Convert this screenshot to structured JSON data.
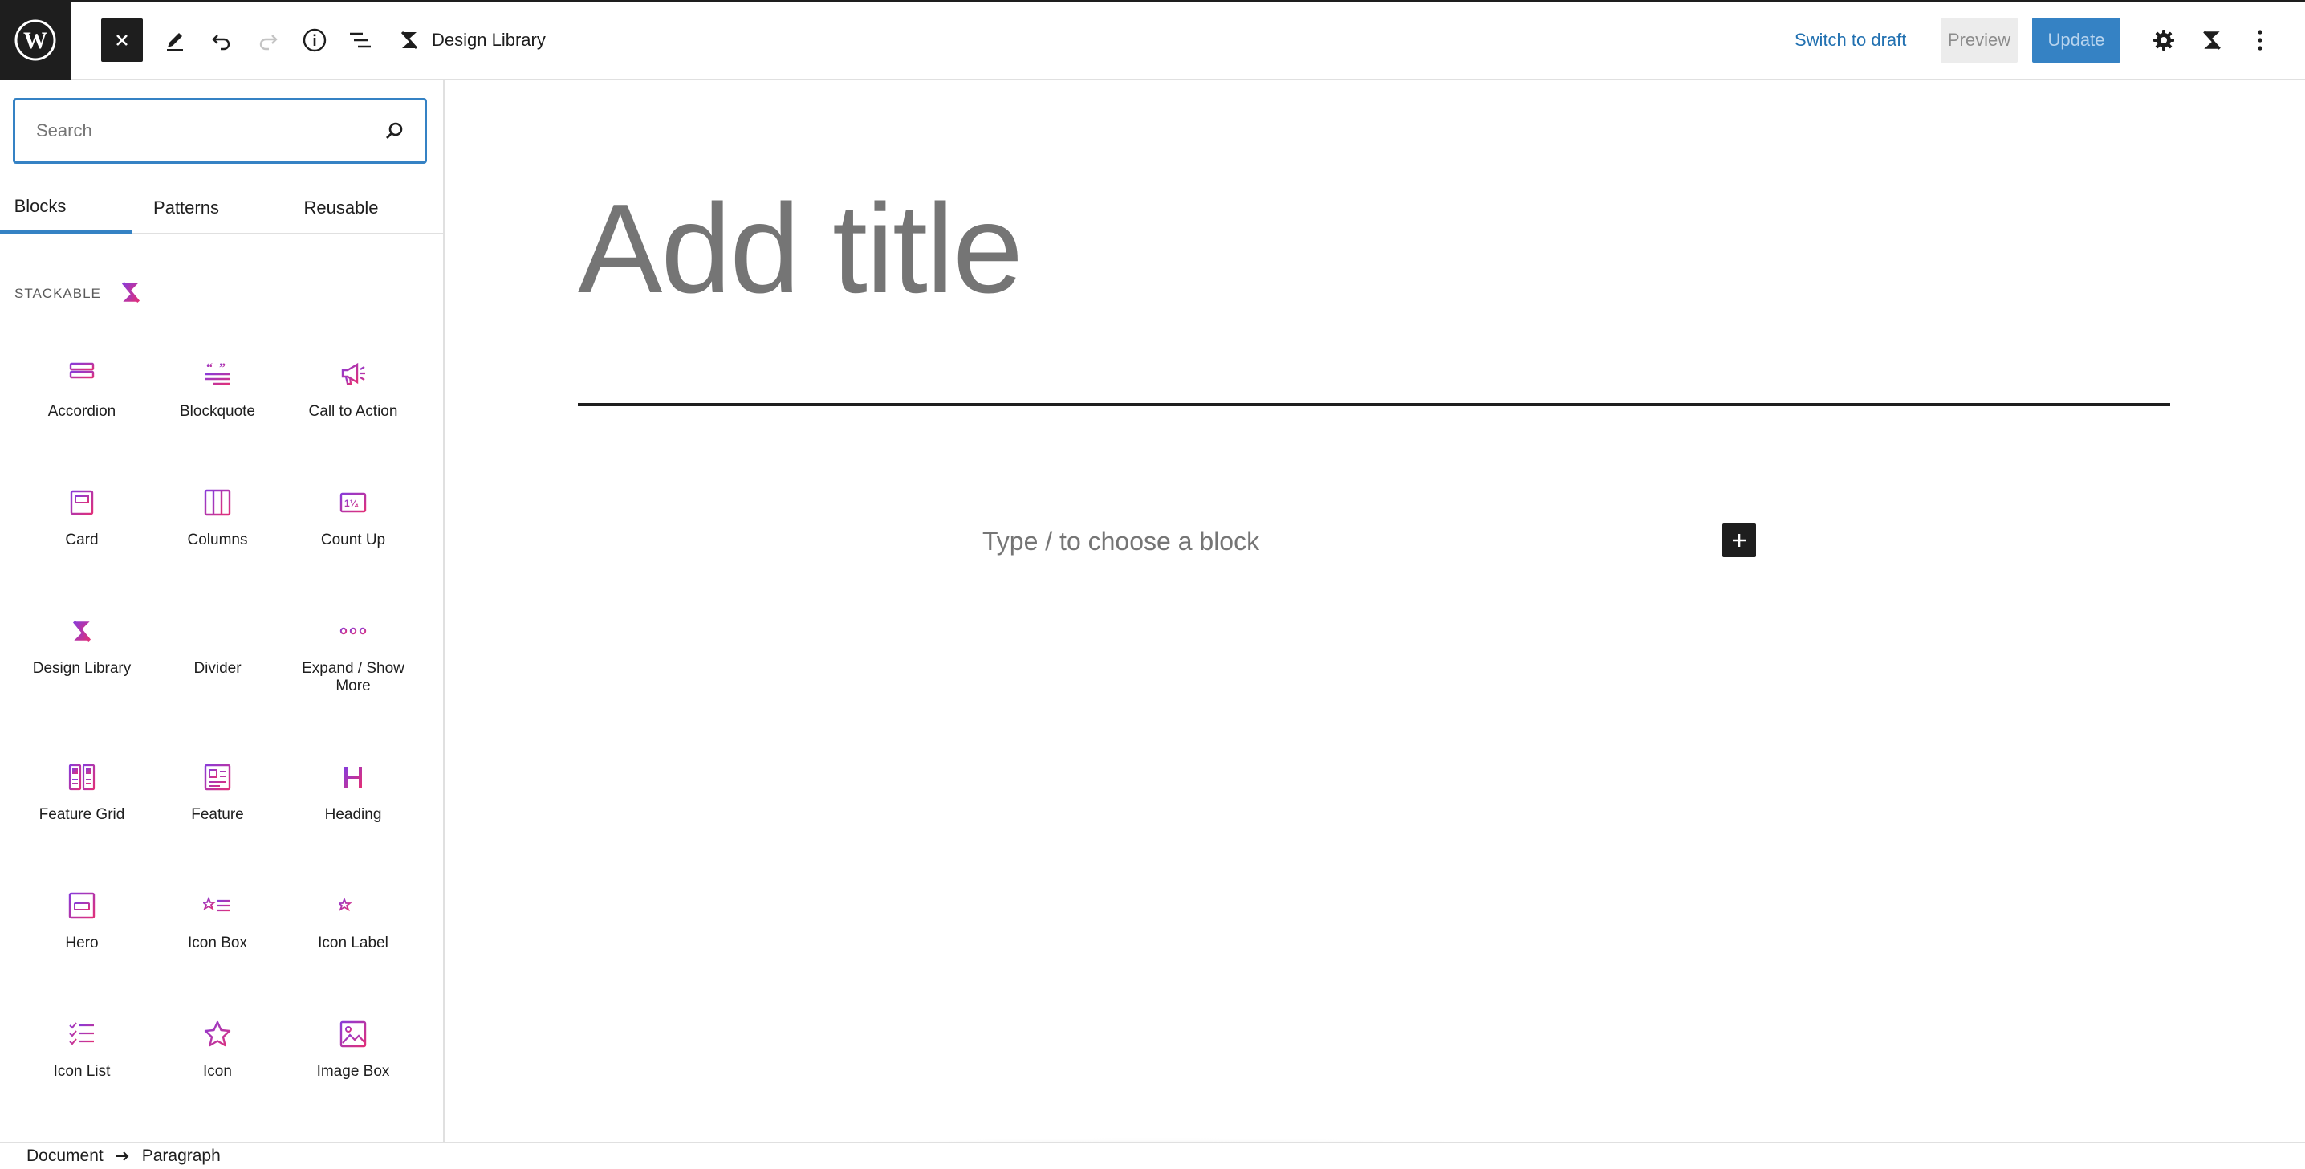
{
  "header": {
    "document_title": "Design Library",
    "switch_to_draft": "Switch to draft",
    "preview": "Preview",
    "update": "Update"
  },
  "search": {
    "placeholder": "Search"
  },
  "tabs": [
    {
      "label": "Blocks",
      "active": true
    },
    {
      "label": "Patterns",
      "active": false
    },
    {
      "label": "Reusable",
      "active": false
    }
  ],
  "category": {
    "label": "STACKABLE"
  },
  "blocks": [
    {
      "label": "Accordion",
      "icon": "accordion-icon"
    },
    {
      "label": "Blockquote",
      "icon": "blockquote-icon"
    },
    {
      "label": "Call to Action",
      "icon": "megaphone-icon"
    },
    {
      "label": "Card",
      "icon": "card-icon"
    },
    {
      "label": "Columns",
      "icon": "columns-icon"
    },
    {
      "label": "Count Up",
      "icon": "count-up-icon"
    },
    {
      "label": "Design Library",
      "icon": "stackable-logo-icon"
    },
    {
      "label": "Divider",
      "icon": "divider-icon"
    },
    {
      "label": "Expand / Show More",
      "icon": "ellipsis-icon"
    },
    {
      "label": "Feature Grid",
      "icon": "feature-grid-icon"
    },
    {
      "label": "Feature",
      "icon": "feature-icon"
    },
    {
      "label": "Heading",
      "icon": "heading-icon"
    },
    {
      "label": "Hero",
      "icon": "hero-icon"
    },
    {
      "label": "Icon Box",
      "icon": "icon-box-icon"
    },
    {
      "label": "Icon Label",
      "icon": "icon-label-icon"
    },
    {
      "label": "Icon List",
      "icon": "icon-list-icon"
    },
    {
      "label": "Icon",
      "icon": "star-icon"
    },
    {
      "label": "Image Box",
      "icon": "image-icon"
    }
  ],
  "editor": {
    "title_placeholder": "Add title",
    "block_placeholder": "Type / to choose a block"
  },
  "breadcrumb": {
    "first": "Document",
    "second": "Paragraph"
  },
  "colors": {
    "accent": "#3582c4",
    "stackable_pink": "#e0307a",
    "stackable_purple": "#8a3bd8"
  }
}
